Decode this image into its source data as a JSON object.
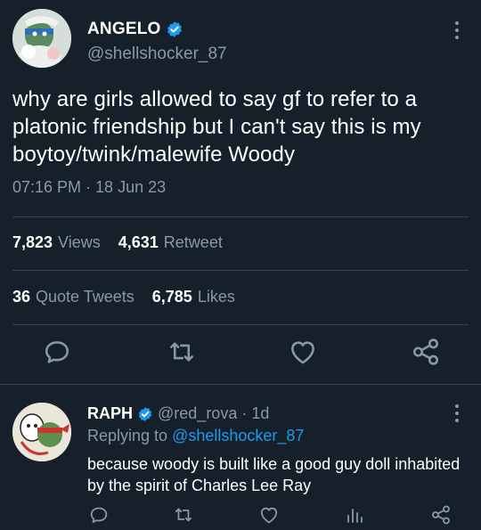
{
  "main_tweet": {
    "display_name": "ANGELO",
    "handle": "@shellshocker_87",
    "text": "why are girls allowed to say gf to refer to a platonic friendship but I can't say this is my boytoy/twink/malewife Woody",
    "timestamp": "07:16 PM · 18 Jun 23",
    "stats": {
      "views_count": "7,823",
      "views_label": "Views",
      "retweet_count": "4,631",
      "retweet_label": "Retweet",
      "quote_count": "36",
      "quote_label": "Quote Tweets",
      "likes_count": "6,785",
      "likes_label": "Likes"
    },
    "icons": [
      "verified-badge",
      "more-icon",
      "reply-icon",
      "retweet-icon",
      "like-icon",
      "share-icon"
    ]
  },
  "reply": {
    "display_name": "RAPH",
    "meta": "@red_rova · 1d",
    "replying_prefix": "Replying to",
    "replying_to": "@shellshocker_87",
    "text": "because woody is built like a good guy doll inhabited by the spirit of Charles Lee Ray",
    "icons": [
      "verified-badge",
      "more-icon",
      "reply-icon",
      "retweet-icon",
      "like-icon",
      "views-icon",
      "share-icon"
    ]
  },
  "colors": {
    "background": "#15202b",
    "text": "#ffffff",
    "muted": "#8b98a5",
    "accent": "#1d9bf0",
    "divider": "#38444d"
  }
}
